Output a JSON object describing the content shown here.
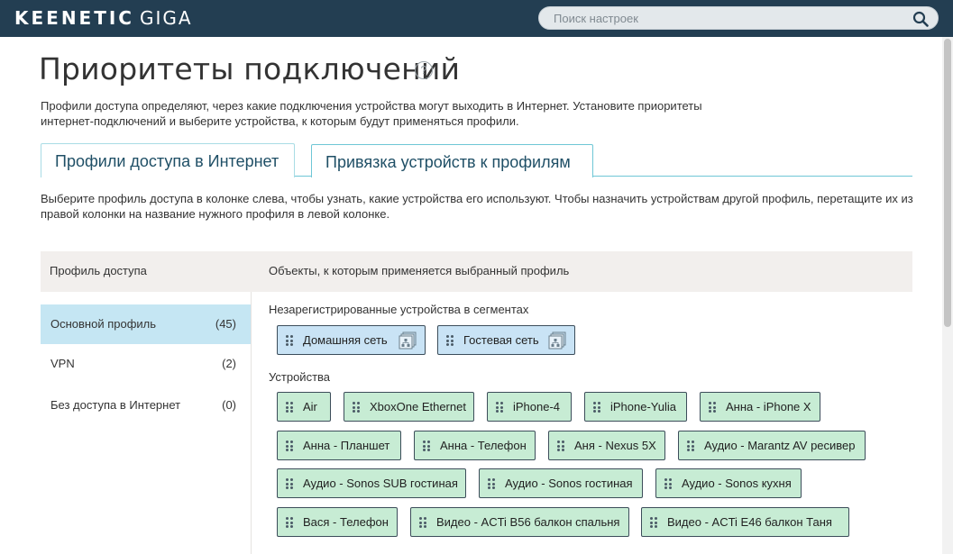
{
  "brand": {
    "name_bold": "KEENETIC",
    "name_light": "GIGA"
  },
  "search": {
    "placeholder": "Поиск настроек",
    "icon": "search-icon"
  },
  "page": {
    "title": "Приоритеты подключений",
    "help_symbol": "?",
    "intro_line1": "Профили доступа определяют, через какие подключения устройства могут выходить в Интернет. Установите приоритеты",
    "intro_line2": "интернет-подключений и выберите устройства, к которым будут применяться профили."
  },
  "tabs": [
    {
      "label": "Профили доступа в Интернет",
      "active": false
    },
    {
      "label": "Привязка устройств к профилям",
      "active": true
    }
  ],
  "description": {
    "line1": "Выберите профиль доступа в колонке слева, чтобы узнать, какие устройства его используют. Чтобы назначить устройствам другой профиль, перетащите их из",
    "line2": "правой колонки на название нужного профиля в левой колонке."
  },
  "table": {
    "col_profile": "Профиль доступа",
    "col_objects": "Объекты, к которым применяется выбранный профиль"
  },
  "profiles": [
    {
      "name": "Основной профиль",
      "count": "(45)",
      "selected": true
    },
    {
      "name": "VPN",
      "count": "(2)",
      "selected": false
    },
    {
      "name": "Без доступа в Интернет",
      "count": "(0)",
      "selected": false
    }
  ],
  "segments_label": "Незарегистрированные устройства в сегментах",
  "segments": [
    {
      "label": "Домашняя сеть",
      "icon": "network-segment-icon"
    },
    {
      "label": "Гостевая сеть",
      "icon": "network-segment-icon"
    }
  ],
  "devices_label": "Устройства",
  "devices": [
    "Air",
    "XboxOne Ethernet",
    "iPhone-4",
    "iPhone-Yulia",
    "Анна - iPhone X",
    "Анна - Планшет",
    "Анна - Телефон",
    "Аня - Nexus 5X",
    "Аудио - Marantz AV ресивер",
    "Аудио - Sonos SUB гостиная",
    "Аудио - Sonos гостиная",
    "Аудио - Sonos кухня",
    "Вася - Телефон",
    "Видео - ACTi B56 балкон спальня",
    "Видео - ACTi E46 балкон Таня"
  ],
  "colors": {
    "header_bg": "#233e52",
    "tab_accent": "#6fc7d6",
    "selected_profile_bg": "#c5e6f3",
    "segment_chip_bg": "#c9e3f5",
    "device_chip_bg": "#c7ecd4"
  }
}
